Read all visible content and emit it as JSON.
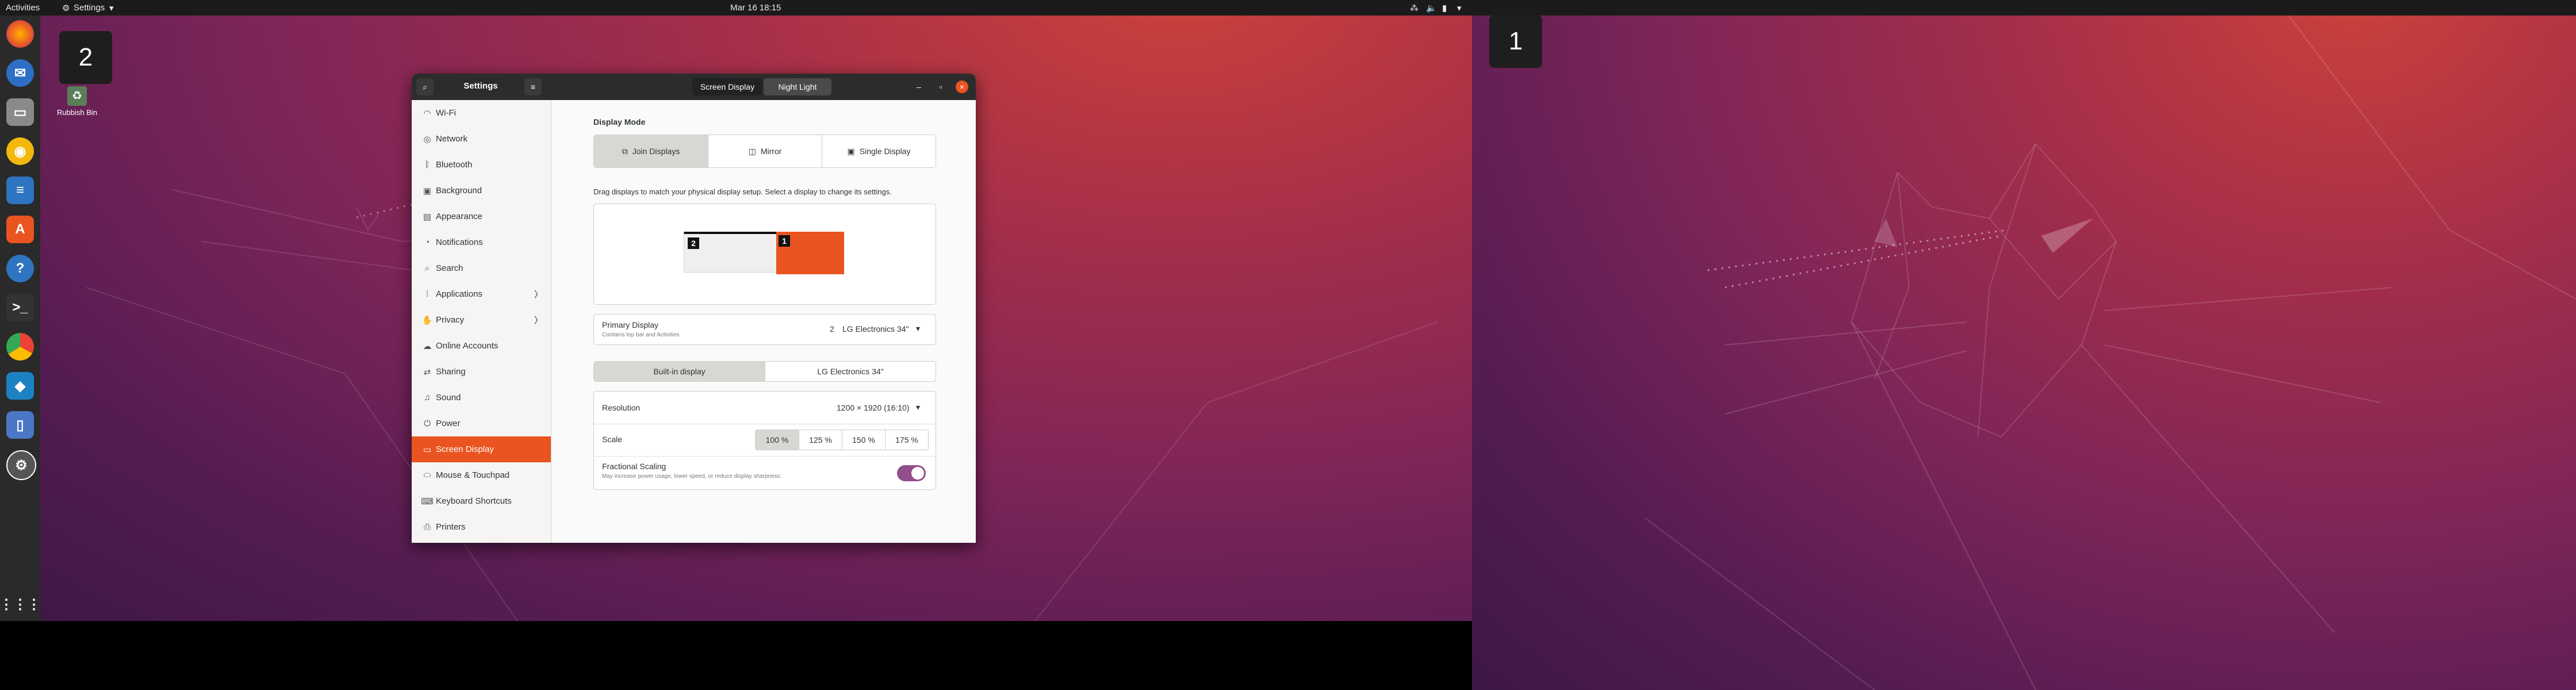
{
  "topbar": {
    "activities": "Activities",
    "app_menu": "Settings",
    "clock": "Mar 16  18:15"
  },
  "workspaces": {
    "left": "2",
    "right": "1"
  },
  "desktop": {
    "rubbish_bin": "Rubbish Bin"
  },
  "window": {
    "title": "Settings",
    "tabs": [
      "Screen Display",
      "Night Light"
    ],
    "active_tab": "Screen Display"
  },
  "sidebar": {
    "items": [
      {
        "label": "Wi-Fi",
        "icon": "wifi-icon"
      },
      {
        "label": "Network",
        "icon": "network-icon"
      },
      {
        "label": "Bluetooth",
        "icon": "bluetooth-icon"
      },
      {
        "label": "Background",
        "icon": "background-icon"
      },
      {
        "label": "Appearance",
        "icon": "appearance-icon"
      },
      {
        "label": "Notifications",
        "icon": "notifications-icon"
      },
      {
        "label": "Search",
        "icon": "search-icon"
      },
      {
        "label": "Applications",
        "icon": "applications-icon"
      },
      {
        "label": "Privacy",
        "icon": "privacy-icon"
      },
      {
        "label": "Online Accounts",
        "icon": "online-accounts-icon"
      },
      {
        "label": "Sharing",
        "icon": "sharing-icon"
      },
      {
        "label": "Sound",
        "icon": "sound-icon"
      },
      {
        "label": "Power",
        "icon": "power-icon"
      },
      {
        "label": "Screen Display",
        "icon": "display-icon"
      },
      {
        "label": "Mouse & Touchpad",
        "icon": "mouse-icon"
      },
      {
        "label": "Keyboard Shortcuts",
        "icon": "keyboard-icon"
      },
      {
        "label": "Printers",
        "icon": "printer-icon"
      }
    ],
    "active": "Screen Display"
  },
  "display": {
    "mode_heading": "Display Mode",
    "modes": [
      "Join Displays",
      "Mirror",
      "Single Display"
    ],
    "active_mode": "Join Displays",
    "instructions": "Drag displays to match your physical display setup. Select a display to change its settings.",
    "arrangement": [
      {
        "number": "2",
        "selected": false
      },
      {
        "number": "1",
        "selected": true
      }
    ],
    "primary_label": "Primary Display",
    "primary_sublabel": "Contains top bar and Activities",
    "primary_number": "2",
    "primary_value": "LG Electronics 34\"",
    "monitor_tabs": [
      "Built-in display",
      "LG Electronics 34\""
    ],
    "active_monitor_tab": "Built-in display",
    "resolution_label": "Resolution",
    "resolution_value": "1200 × 1920 (16:10)",
    "scale_label": "Scale",
    "scales": [
      "100 %",
      "125 %",
      "150 %",
      "175 %"
    ],
    "active_scale": "100 %",
    "fractional_label": "Fractional Scaling",
    "fractional_sublabel": "May increase power usage, lower speed, or reduce display sharpness.",
    "fractional_enabled": true
  },
  "colors": {
    "accent": "#e95420",
    "toggle": "#924d8b",
    "topbar": "#1b1b1b",
    "dock": "#2a2a2a"
  }
}
